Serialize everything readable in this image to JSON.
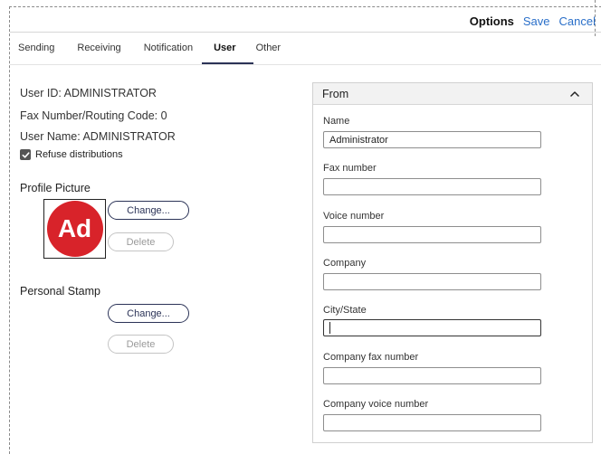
{
  "header": {
    "title": "Options",
    "save_label": "Save",
    "cancel_label": "Cancel"
  },
  "tabs": [
    {
      "label": "Sending",
      "active": false
    },
    {
      "label": "Receiving",
      "active": false
    },
    {
      "label": "Notification",
      "active": false
    },
    {
      "label": "User",
      "active": true
    },
    {
      "label": "Other",
      "active": false
    }
  ],
  "user": {
    "id_line": "User ID: ADMINISTRATOR",
    "fax_line": "Fax Number/Routing Code: 0",
    "name_line": "User Name: ADMINISTRATOR",
    "refuse_label": "Refuse distributions",
    "refuse_checked": true
  },
  "profile": {
    "label": "Profile Picture",
    "avatar_text": "Ad",
    "avatar_color": "#d8232a",
    "change_label": "Change...",
    "delete_label": "Delete"
  },
  "stamp": {
    "label": "Personal Stamp",
    "change_label": "Change...",
    "delete_label": "Delete"
  },
  "from": {
    "title": "From",
    "collapse_icon": "chevron-up-icon",
    "fields": [
      {
        "label": "Name",
        "value": "Administrator"
      },
      {
        "label": "Fax number",
        "value": ""
      },
      {
        "label": "Voice number",
        "value": ""
      },
      {
        "label": "Company",
        "value": ""
      },
      {
        "label": "City/State",
        "value": "",
        "focused": true
      },
      {
        "label": "Company fax number",
        "value": ""
      },
      {
        "label": "Company voice number",
        "value": ""
      }
    ]
  },
  "colors": {
    "accent": "#2b3357",
    "link": "#2a6fc9"
  }
}
